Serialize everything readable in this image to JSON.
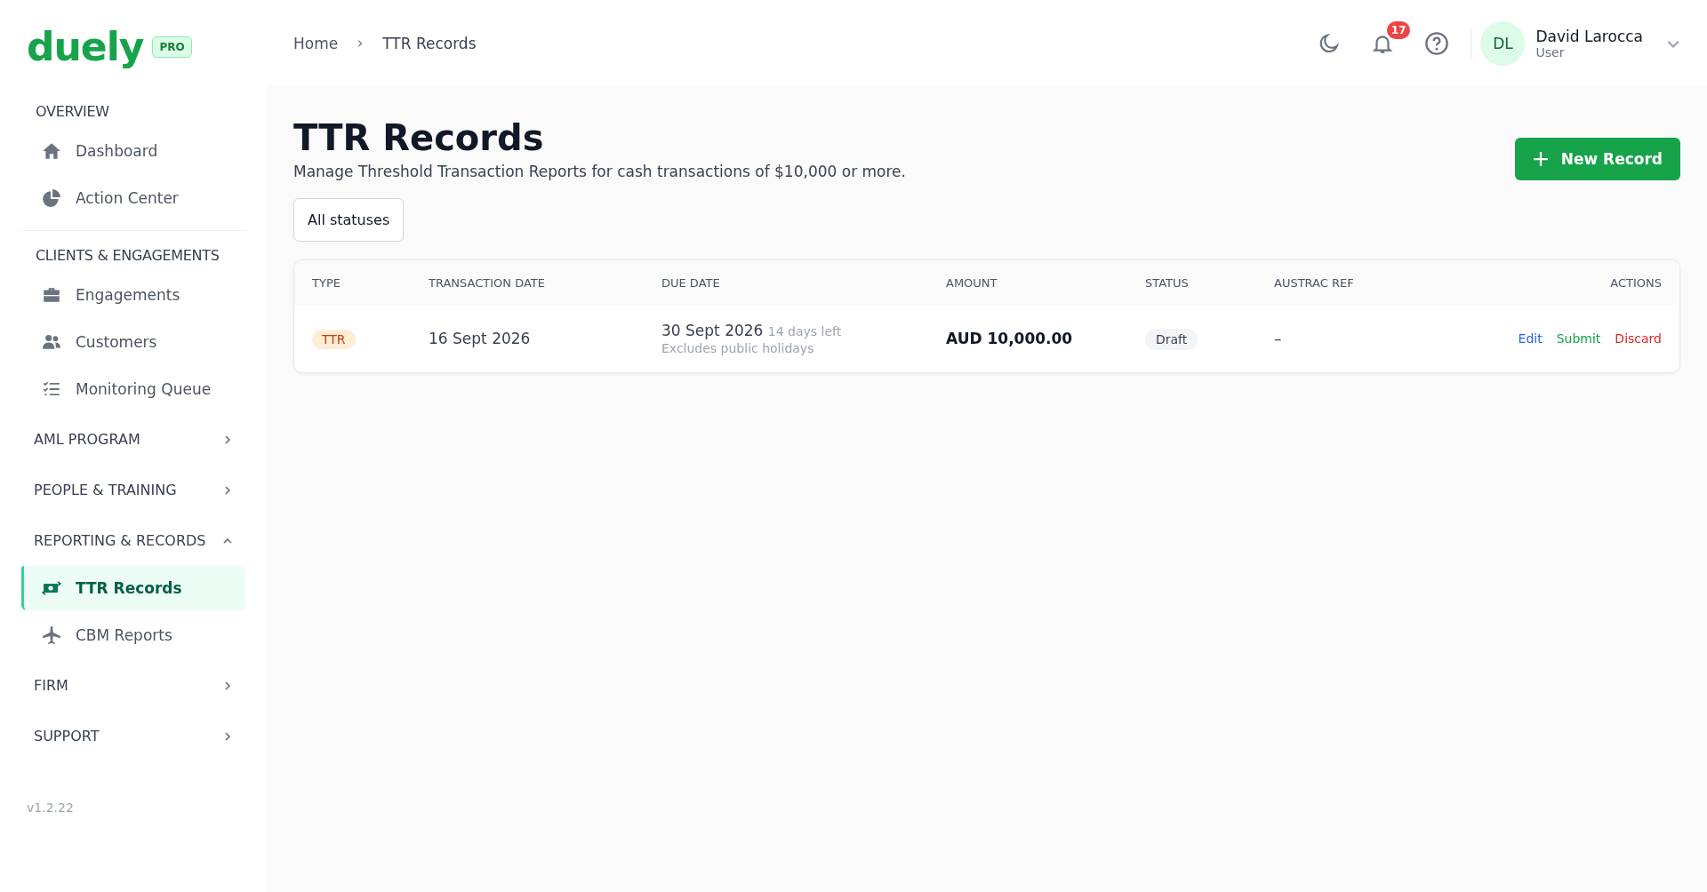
{
  "sidebar": {
    "logo": "duely",
    "badge": "PRO",
    "sections": [
      {
        "title": "OVERVIEW",
        "kind": "static",
        "items": [
          {
            "label": "Dashboard",
            "selected": false
          },
          {
            "label": "Action Center",
            "selected": false
          }
        ]
      },
      {
        "title": "CLIENTS & ENGAGEMENTS",
        "kind": "static",
        "items": [
          {
            "label": "Engagements",
            "selected": false
          },
          {
            "label": "Customers",
            "selected": false
          },
          {
            "label": "Monitoring Queue",
            "selected": false
          }
        ]
      },
      {
        "title": "AML PROGRAM",
        "kind": "collapsible",
        "expanded": false
      },
      {
        "title": "PEOPLE & TRAINING",
        "kind": "collapsible",
        "expanded": false
      },
      {
        "title": "REPORTING & RECORDS",
        "kind": "collapsible",
        "expanded": true,
        "items": [
          {
            "label": "TTR Records",
            "selected": true
          },
          {
            "label": "CBM Reports",
            "selected": false
          }
        ]
      },
      {
        "title": "FIRM",
        "kind": "collapsible",
        "expanded": false
      },
      {
        "title": "SUPPORT",
        "kind": "collapsible",
        "expanded": false
      }
    ],
    "version": "v1.2.22"
  },
  "breadcrumb": [
    "Home",
    "TTR Records"
  ],
  "header": {
    "notifications": "17",
    "user": {
      "initials": "DL",
      "name": "David Larocca",
      "role": "User"
    }
  },
  "page": {
    "title": "TTR Records",
    "subtitle": "Manage Threshold Transaction Reports for cash transactions of $10,000 or more.",
    "new_button": "New Record",
    "filter": "All statuses"
  },
  "table": {
    "columns": [
      "TYPE",
      "TRANSACTION DATE",
      "DUE DATE",
      "AMOUNT",
      "STATUS",
      "AUSTRAC REF",
      "ACTIONS"
    ],
    "rows": [
      {
        "type": "TTR",
        "transaction_date": "16 Sept 2026",
        "due_date": "30 Sept 2026",
        "days_left": "14 days left",
        "due_note": "Excludes public holidays",
        "amount": "AUD 10,000.00",
        "status": "Draft",
        "austrac_ref": "–",
        "actions": [
          "Edit",
          "Submit",
          "Discard"
        ]
      }
    ]
  }
}
